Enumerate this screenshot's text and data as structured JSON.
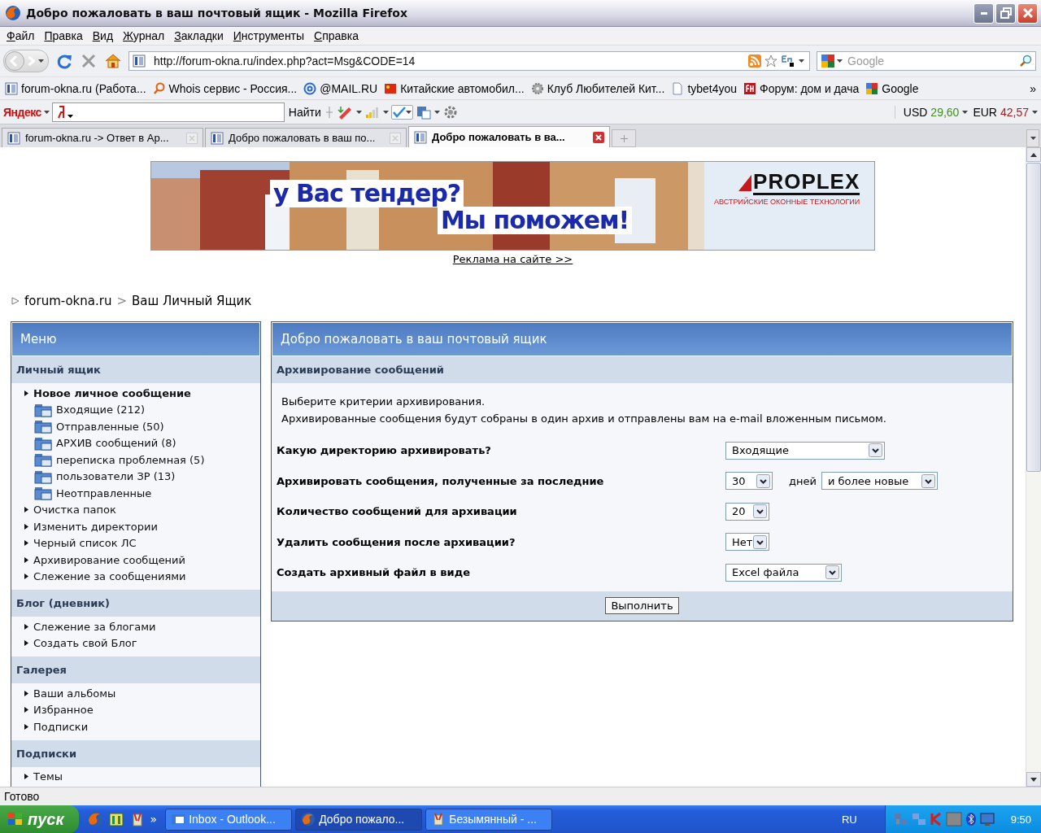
{
  "window": {
    "title": "Добро пожаловать в ваш почтовый ящик - Mozilla Firefox"
  },
  "menu": [
    "Файл",
    "Правка",
    "Вид",
    "Журнал",
    "Закладки",
    "Инструменты",
    "Справка"
  ],
  "nav": {
    "url": "http://forum-okna.ru/index.php?act=Msg&CODE=14",
    "search_placeholder": "Google"
  },
  "bookmarks": [
    {
      "label": "forum-okna.ru (Работа..."
    },
    {
      "label": "Whois сервис - Россия..."
    },
    {
      "label": "@MAIL.RU"
    },
    {
      "label": "Китайские автомобил..."
    },
    {
      "label": "Клуб Любителей Кит..."
    },
    {
      "label": "tybet4you"
    },
    {
      "label": "Форум: дом и дача"
    },
    {
      "label": "Google"
    }
  ],
  "bookmarks_more": "»",
  "yandex": {
    "logo": "Яндекс",
    "find_button": "Найти",
    "currencies": [
      {
        "label": "USD",
        "value": "29,60",
        "color": "#3f8f1f"
      },
      {
        "label": "EUR",
        "value": "42,57",
        "color": "#b01818"
      }
    ]
  },
  "tabs": [
    {
      "label": "forum-okna.ru -> Ответ в Ар...",
      "selected": false
    },
    {
      "label": "Добро пожаловать в ваш по...",
      "selected": false
    },
    {
      "label": "Добро пожаловать в ва...",
      "selected": true
    }
  ],
  "banner": {
    "headline_1": "у Вас тендер?",
    "headline_2": "Мы поможем!",
    "brand": "PROPLEX",
    "tagline": "АВСТРИЙСКИЕ ОКОННЫЕ ТЕХНОЛОГИИ"
  },
  "ad_link": "Реклама на сайте >>",
  "breadcrumb": [
    "forum-okna.ru",
    "Ваш Личный Ящик"
  ],
  "breadcrumb_separator": ">",
  "sidebar": {
    "title": "Меню",
    "sections": [
      {
        "title": "Личный ящик",
        "items": [
          {
            "label": "Новое личное сообщение",
            "kind": "link",
            "bold": true
          },
          {
            "label": "Входящие (212)",
            "kind": "folder",
            "bold": false
          },
          {
            "label": "Отправленные (50)",
            "kind": "folder",
            "bold": false
          },
          {
            "label": "АРХИВ сообщений (8)",
            "kind": "folder",
            "bold": false
          },
          {
            "label": "переписка проблемная (5)",
            "kind": "folder",
            "bold": false
          },
          {
            "label": "пользователи ЗР (13)",
            "kind": "folder",
            "bold": false
          },
          {
            "label": "Неотправленные",
            "kind": "folder",
            "bold": false
          },
          {
            "label": "Очистка папок",
            "kind": "link",
            "bold": false
          },
          {
            "label": "Изменить директории",
            "kind": "link",
            "bold": false
          },
          {
            "label": "Черный список ЛС",
            "kind": "link",
            "bold": false
          },
          {
            "label": "Архивирование сообщений",
            "kind": "link",
            "bold": false
          },
          {
            "label": "Слежение за сообщениями",
            "kind": "link",
            "bold": false
          }
        ]
      },
      {
        "title": "Блог (дневник)",
        "items": [
          {
            "label": "Слежение за блогами",
            "kind": "link",
            "bold": false
          },
          {
            "label": "Создать свой Блог",
            "kind": "link",
            "bold": false
          }
        ]
      },
      {
        "title": "Галерея",
        "items": [
          {
            "label": "Ваши альбомы",
            "kind": "link",
            "bold": false
          },
          {
            "label": "Избранное",
            "kind": "link",
            "bold": false
          },
          {
            "label": "Подписки",
            "kind": "link",
            "bold": false
          }
        ]
      },
      {
        "title": "Подписки",
        "items": [
          {
            "label": "Темы",
            "kind": "link",
            "bold": false
          }
        ]
      }
    ]
  },
  "main": {
    "title": "Добро пожаловать в ваш почтовый ящик",
    "subtitle": "Архивирование сообщений",
    "intro": [
      "Выберите критерии архивирования.",
      "Архивированные сообщения будут собраны в один архив и отправлены вам на e-mail вложенным письмом."
    ],
    "fields": [
      {
        "label": "Какую директорию архивировать?",
        "controls": [
          {
            "kind": "select",
            "value": "Входящие"
          }
        ]
      },
      {
        "label": "Архивировать сообщения, полученные за последние",
        "controls": [
          {
            "kind": "select",
            "value": "30"
          },
          {
            "kind": "text",
            "text": "дней"
          },
          {
            "kind": "select",
            "value": "и более новые"
          }
        ]
      },
      {
        "label": "Количество сообщений для архивации",
        "controls": [
          {
            "kind": "select",
            "value": "20"
          }
        ]
      },
      {
        "label": "Удалить сообщения после архивации?",
        "controls": [
          {
            "kind": "select",
            "value": "Нет"
          }
        ]
      },
      {
        "label": "Создать архивный файл в виде",
        "controls": [
          {
            "kind": "select",
            "value": "Excel файла"
          }
        ]
      }
    ],
    "submit": "Выполнить"
  },
  "status_bar": "Готово",
  "taskbar": {
    "start": "пуск",
    "quick_more": "»",
    "tasks": [
      {
        "label": "Inbox - Outlook...",
        "selected": false
      },
      {
        "label": "Добро пожало...",
        "selected": true
      },
      {
        "label": "Безымянный - ...",
        "selected": false
      }
    ],
    "language": "RU",
    "clock": "9:50"
  }
}
